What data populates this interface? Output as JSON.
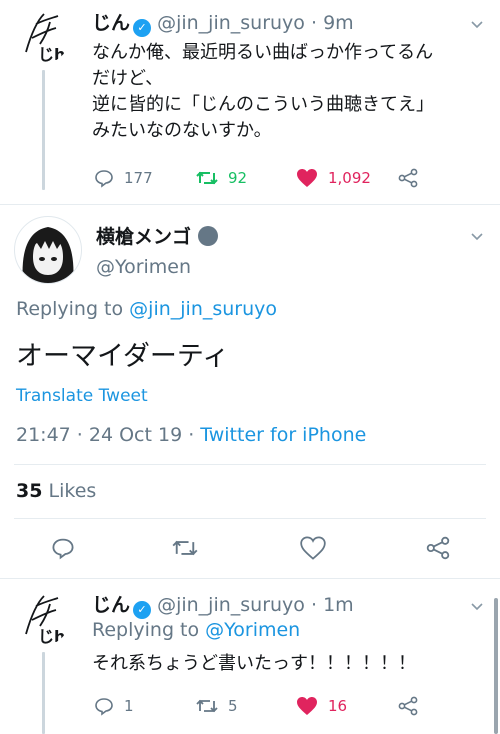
{
  "tweet1": {
    "name": "じん",
    "handle": "@jin_jin_suruyo",
    "time": "· 9m",
    "text_lines": [
      "なんか俺、最近明るい曲ばっか作ってるん",
      "だけど、",
      "逆に皆的に「じんのこういう曲聴きてえ」",
      "みたいなのないすか。"
    ],
    "replies": "177",
    "retweets": "92",
    "likes": "1,092"
  },
  "main_tweet": {
    "name": "横槍メンゴ",
    "handle": "@Yorimen",
    "replying_prefix": "Replying to",
    "replying_to": "@jin_jin_suruyo",
    "text": "オーマイダーティ",
    "translate": "Translate Tweet",
    "timestamp": "21:47 · 24 Oct 19 · ",
    "source": "Twitter for iPhone",
    "likes_count": "35",
    "likes_label": "Likes"
  },
  "tweet3": {
    "name": "じん",
    "handle": "@jin_jin_suruyo",
    "time": "· 1m",
    "replying_prefix": "Replying to",
    "replying_to": "@Yorimen",
    "text": "それ系ちょうど書いたっす！！！！！！",
    "replies": "1",
    "retweets": "5",
    "likes": "16"
  },
  "colors": {
    "accent": "#1b95e0",
    "retweet_green": "#17bf63",
    "like_red": "#e0245e",
    "secondary_text": "#657786"
  },
  "icons": [
    "chevron-down-icon",
    "verified-badge-icon",
    "reply-icon",
    "retweet-icon",
    "like-icon",
    "share-icon"
  ]
}
